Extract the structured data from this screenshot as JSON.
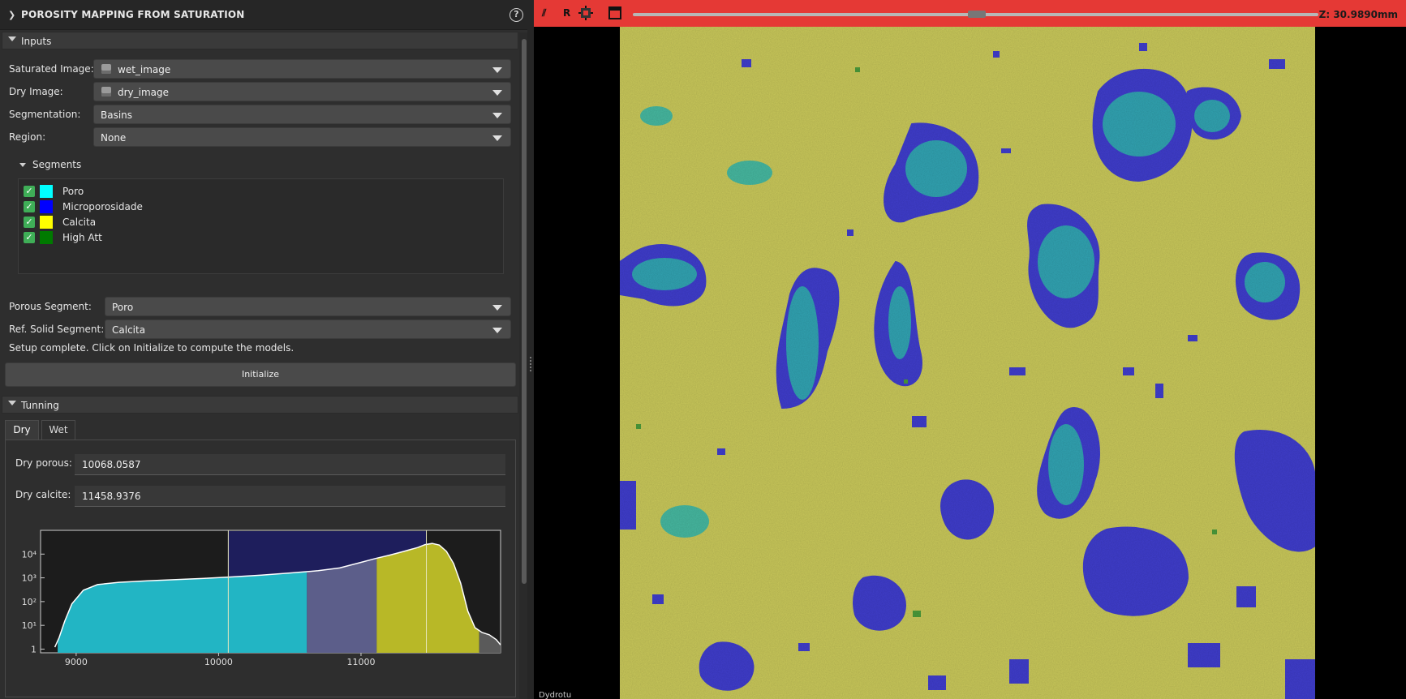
{
  "panel": {
    "title": "POROSITY MAPPING FROM SATURATION",
    "help_icon": "?"
  },
  "inputs": {
    "header": "Inputs",
    "saturated_label": "Saturated Image:",
    "saturated_value": "wet_image",
    "dry_label": "Dry Image:",
    "dry_value": "dry_image",
    "segmentation_label": "Segmentation:",
    "segmentation_value": "Basins",
    "region_label": "Region:",
    "region_value": "None",
    "segments_header": "Segments",
    "segments": [
      {
        "name": "Poro",
        "color": "#00ffff",
        "checked": true
      },
      {
        "name": "Microporosidade",
        "color": "#0000ff",
        "checked": true
      },
      {
        "name": "Calcita",
        "color": "#ffff00",
        "checked": true
      },
      {
        "name": "High Att",
        "color": "#007a00",
        "checked": true
      }
    ],
    "porous_label": "Porous Segment:",
    "porous_value": "Poro",
    "solid_label": "Ref. Solid Segment:",
    "solid_value": "Calcita",
    "status": "Setup complete. Click on Initialize to compute the models.",
    "initialize_label": "Initialize"
  },
  "tunning": {
    "header": "Tunning",
    "tabs": [
      "Dry",
      "Wet"
    ],
    "active_tab": "Dry",
    "dry_porous_label": "Dry porous:",
    "dry_porous_value": "10068.0587",
    "dry_calcite_label": "Dry calcite:",
    "dry_calcite_value": "11458.9376"
  },
  "chart_data": {
    "type": "area",
    "title": "",
    "xlabel": "",
    "ylabel": "",
    "y_scale": "log",
    "xlim": [
      8750,
      11980
    ],
    "ylim": [
      0.7,
      100000
    ],
    "x_ticks": [
      9000,
      10000,
      11000
    ],
    "y_ticks": [
      {
        "value": 1,
        "label": "1"
      },
      {
        "value": 10,
        "label": "10¹"
      },
      {
        "value": 100,
        "label": "10²"
      },
      {
        "value": 1000,
        "label": "10³"
      },
      {
        "value": 10000,
        "label": "10⁴"
      }
    ],
    "series": [
      {
        "x": [
          8850,
          8880,
          8920,
          8970,
          9050,
          9150,
          9300,
          9500,
          9700,
          9900,
          10100,
          10300,
          10500,
          10700,
          10850,
          11000,
          11100,
          11200,
          11300,
          11400,
          11450,
          11500,
          11550,
          11600,
          11650,
          11700,
          11750,
          11800,
          11850,
          11900,
          11950,
          11980
        ],
        "y": [
          1.2,
          3,
          15,
          80,
          300,
          520,
          650,
          750,
          850,
          950,
          1100,
          1300,
          1600,
          2000,
          2600,
          4500,
          6500,
          9000,
          13000,
          19000,
          25000,
          28000,
          24000,
          13000,
          4000,
          600,
          40,
          8,
          5,
          4,
          2.5,
          1.5
        ]
      }
    ],
    "regions": [
      {
        "from": 8870,
        "to": 10620,
        "color": "#22b5c4"
      },
      {
        "from": 10620,
        "to": 11110,
        "color": "#5c5e8a"
      },
      {
        "from": 11110,
        "to": 11830,
        "color": "#b8b827"
      },
      {
        "from": 11830,
        "to": 11980,
        "color": "#5a5a5a"
      }
    ],
    "markers": [
      10068.0587,
      11458.9376
    ],
    "highlight_range": [
      10068.0587,
      11458.9376
    ],
    "grid": false
  },
  "viewer": {
    "zoom_label": "Z: 30.9890mm",
    "toolbar_letter": "R",
    "corner_text": "Dydrotu"
  }
}
